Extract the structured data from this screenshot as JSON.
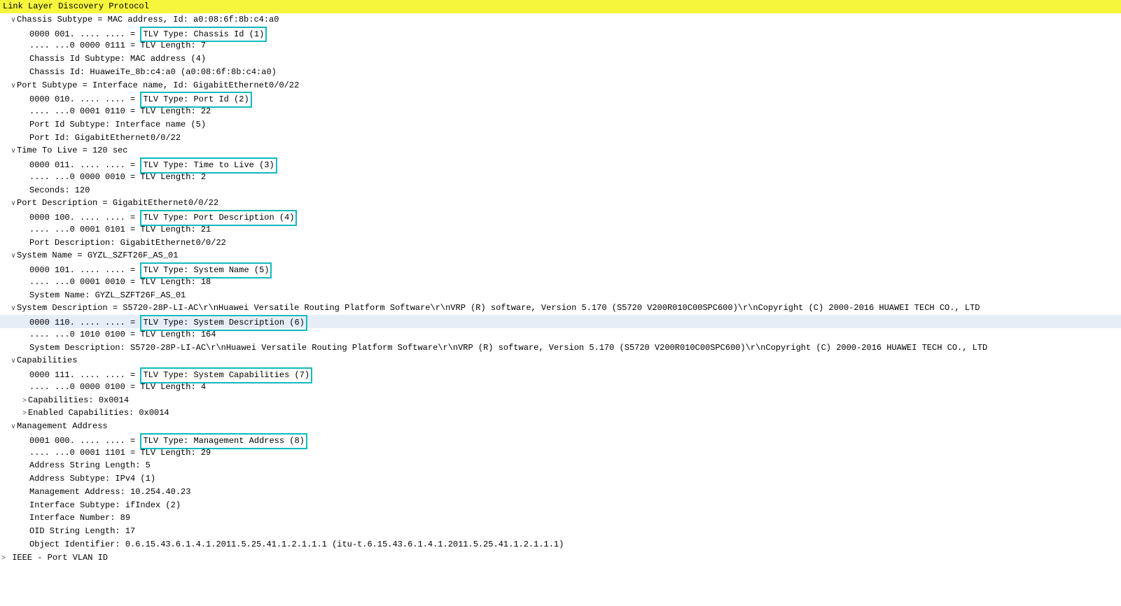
{
  "header": "Link Layer Discovery Protocol",
  "footer_prefix": ">",
  "footer_label": "IEEE - Port VLAN ID",
  "tlvs": [
    {
      "header": "Chassis Subtype = MAC address, Id: a0:08:6f:8b:c4:a0",
      "hl_bits": "0000 001. .... .... =",
      "hl_type": "TLV Type: Chassis Id (1)",
      "lines": [
        ".... ...0 0000 0111 = TLV Length: 7",
        "Chassis Id Subtype: MAC address (4)",
        "Chassis Id: HuaweiTe_8b:c4:a0 (a0:08:6f:8b:c4:a0)"
      ]
    },
    {
      "header": "Port Subtype = Interface name, Id: GigabitEthernet0/0/22",
      "hl_bits": "0000 010. .... .... =",
      "hl_type": "TLV Type: Port Id (2)",
      "lines": [
        ".... ...0 0001 0110 = TLV Length: 22",
        "Port Id Subtype: Interface name (5)",
        "Port Id: GigabitEthernet0/0/22"
      ]
    },
    {
      "header": "Time To Live = 120 sec",
      "hl_bits": "0000 011. .... .... =",
      "hl_type": "TLV Type: Time to Live (3)",
      "lines": [
        ".... ...0 0000 0010 = TLV Length: 2",
        "Seconds: 120"
      ]
    },
    {
      "header": "Port Description = GigabitEthernet0/0/22",
      "hl_bits": "0000 100. .... .... =",
      "hl_type": "TLV Type: Port Description (4)",
      "lines": [
        ".... ...0 0001 0101 = TLV Length: 21",
        "Port Description: GigabitEthernet0/0/22"
      ]
    },
    {
      "header": "System Name = GYZL_SZFT26F_AS_01",
      "hl_bits": "0000 101. .... .... =",
      "hl_type": "TLV Type: System Name (5)",
      "lines": [
        ".... ...0 0001 0010 = TLV Length: 18",
        "System Name: GYZL_SZFT26F_AS_01"
      ]
    },
    {
      "header": "System Description = S5720-28P-LI-AC\\r\\nHuawei Versatile Routing Platform Software\\r\\nVRP (R) software, Version 5.170 (S5720 V200R010C00SPC600)\\r\\nCopyright (C) 2000-2016 HUAWEI TECH CO., LTD",
      "hl_bits": "0000 110. .... .... =",
      "hl_type": "TLV Type: System Description (6)",
      "hl_selected": true,
      "lines": [
        ".... ...0 1010 0100 = TLV Length: 164",
        "System Description: S5720-28P-LI-AC\\r\\nHuawei Versatile Routing Platform Software\\r\\nVRP (R) software, Version 5.170 (S5720 V200R010C00SPC600)\\r\\nCopyright (C) 2000-2016 HUAWEI TECH CO., LTD"
      ]
    },
    {
      "header": "Capabilities",
      "hl_bits": "0000 111. .... .... =",
      "hl_type": "TLV Type: System Capabilities (7)",
      "lines": [
        ".... ...0 0000 0100 = TLV Length: 4",
        {
          "collapsed": true,
          "text": "Capabilities: 0x0014"
        },
        {
          "collapsed": true,
          "text": "Enabled Capabilities: 0x0014"
        }
      ]
    },
    {
      "header": "Management Address",
      "hl_bits": "0001 000. .... .... =",
      "hl_type": "TLV Type: Management Address (8)",
      "lines": [
        ".... ...0 0001 1101 = TLV Length: 29",
        "Address String Length: 5",
        "Address Subtype: IPv4 (1)",
        "Management Address: 10.254.40.23",
        "Interface Subtype: ifIndex (2)",
        "Interface Number: 89",
        "OID String Length: 17",
        "Object Identifier: 0.6.15.43.6.1.4.1.2011.5.25.41.1.2.1.1.1 (itu-t.6.15.43.6.1.4.1.2011.5.25.41.1.2.1.1.1)"
      ]
    }
  ]
}
